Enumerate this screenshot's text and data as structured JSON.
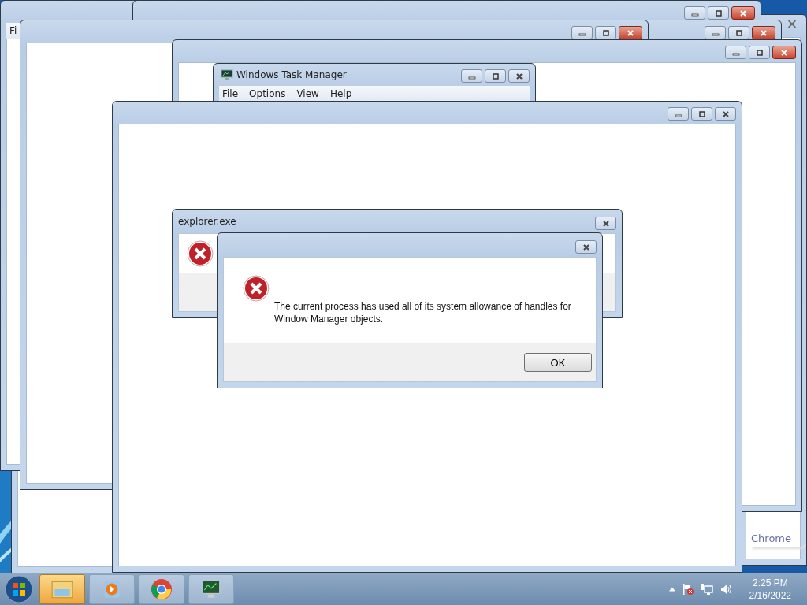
{
  "windows": [
    {
      "kind": "frame"
    },
    {
      "kind": "browser",
      "label": "Chrome"
    },
    {
      "kind": "frame",
      "menu": [
        "Fi"
      ]
    },
    {
      "kind": "frame",
      "buttons": true,
      "active_close": true
    },
    {
      "kind": "frame",
      "buttons": true,
      "active_close": true
    },
    {
      "kind": "frame",
      "buttons": true,
      "active_close": true
    },
    {
      "kind": "frame",
      "buttons": true,
      "active_close": true
    },
    {
      "kind": "app",
      "title": "Windows Task Manager",
      "menu": [
        "File",
        "Options",
        "View",
        "Help"
      ],
      "active_close": false
    },
    {
      "kind": "frame",
      "buttons": true,
      "active_close": false
    },
    {
      "kind": "dialog",
      "title": "explorer.exe"
    },
    {
      "kind": "message",
      "text": "The current process has used all of its system allowance of handles for Window Manager objects.",
      "button": "OK"
    }
  ],
  "taskbar": {
    "apps": [
      {
        "kind": "folder",
        "selected": true
      },
      {
        "kind": "media",
        "selected": false
      },
      {
        "kind": "browser",
        "selected": false
      },
      {
        "kind": "monitor",
        "selected": false
      }
    ],
    "clock": {
      "time": "2:25 PM",
      "date": "2/16/2022"
    }
  }
}
